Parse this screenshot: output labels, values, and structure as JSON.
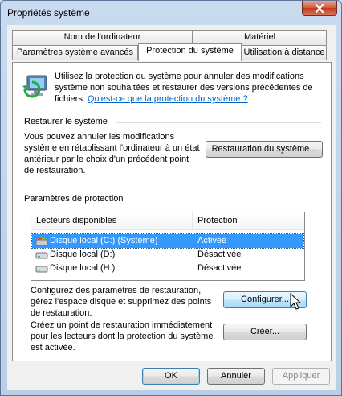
{
  "window": {
    "title": "Propriétés système"
  },
  "tabs": {
    "row1": [
      {
        "label": "Nom de l'ordinateur"
      },
      {
        "label": "Matériel"
      }
    ],
    "row2": [
      {
        "label": "Paramètres système avancés"
      },
      {
        "label": "Protection du système",
        "active": true
      },
      {
        "label": "Utilisation à distance"
      }
    ]
  },
  "intro": {
    "text": "Utilisez la protection du système pour annuler des modifications système non souhaitées et restaurer des versions précédentes de fichiers.",
    "link": "Qu'est-ce que la protection du système ?",
    "icon": "system-protection-icon"
  },
  "restore": {
    "heading": "Restaurer le système",
    "text": "Vous pouvez annuler les modifications système en rétablissant l'ordinateur à un état antérieur par le choix d'un précédent point de restauration.",
    "button": "Restauration du système..."
  },
  "protection": {
    "heading": "Paramètres de protection",
    "columns": [
      "Lecteurs disponibles",
      "Protection"
    ],
    "drives": [
      {
        "name": "Disque local (C:) (Système)",
        "status": "Activée",
        "selected": true,
        "icon": "system-drive-icon"
      },
      {
        "name": "Disque local (D:)",
        "status": "Désactivée",
        "selected": false,
        "icon": "drive-icon"
      },
      {
        "name": "Disque local (H:)",
        "status": "Désactivée",
        "selected": false,
        "icon": "drive-icon"
      }
    ],
    "configure_text": "Configurez des paramètres de restauration, gérez l'espace disque et supprimez des points de restauration.",
    "configure_button": "Configurer...",
    "create_text": "Créez un point de restauration immédiatement pour les lecteurs dont la protection du système est activée.",
    "create_button": "Créer..."
  },
  "footer": {
    "ok": "OK",
    "cancel": "Annuler",
    "apply": "Appliquer"
  },
  "colors": {
    "selection": "#3399ff",
    "link": "#0066cc",
    "close": "#c13a22"
  }
}
